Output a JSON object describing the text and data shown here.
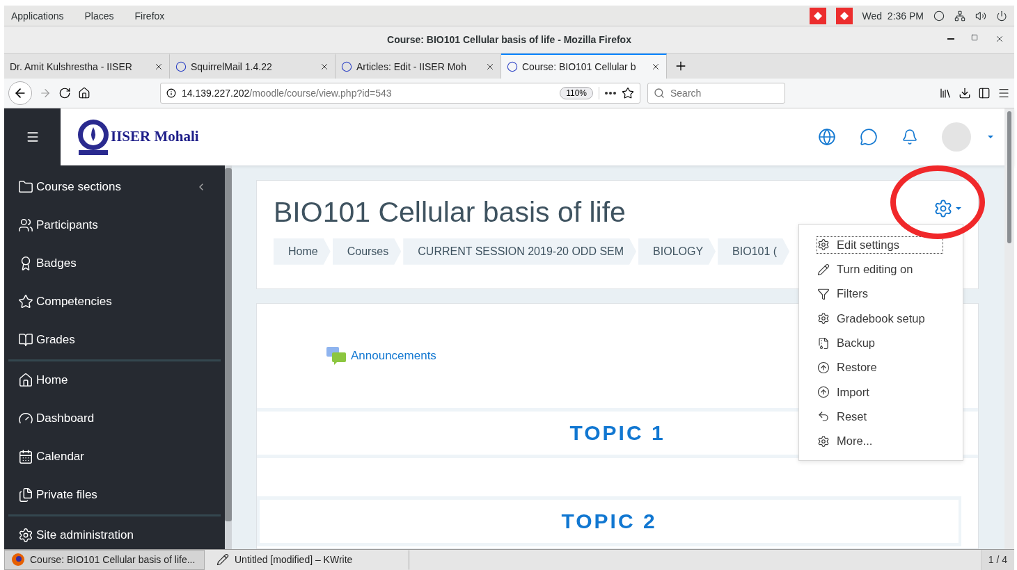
{
  "top_bar": {
    "menus": [
      "Applications",
      "Places",
      "Firefox"
    ],
    "clock": "Wed  2:36 PM"
  },
  "window": {
    "title": "Course: BIO101 Cellular basis of life - Mozilla Firefox"
  },
  "tabs": [
    {
      "label": "Dr. Amit Kulshrestha - IISER",
      "selected": false
    },
    {
      "label": "SquirrelMail 1.4.22",
      "selected": false
    },
    {
      "label": "Articles: Edit - IISER Moh",
      "selected": false
    },
    {
      "label": "Course: BIO101 Cellular b",
      "selected": true
    }
  ],
  "address_bar": {
    "host": "14.139.227.202",
    "path": "/moodle/course/view.php?id=543",
    "zoom": "110%"
  },
  "search": {
    "placeholder": "Search"
  },
  "site": {
    "logo": "IISER Mohali"
  },
  "sidebar": {
    "groups": [
      [
        {
          "label": "Course sections",
          "collapsible": true
        },
        {
          "label": "Participants",
          "collapsible": false
        },
        {
          "label": "Badges",
          "collapsible": false
        },
        {
          "label": "Competencies",
          "collapsible": false
        },
        {
          "label": "Grades",
          "collapsible": false
        }
      ],
      [
        {
          "label": "Home",
          "collapsible": false
        },
        {
          "label": "Dashboard",
          "collapsible": false
        },
        {
          "label": "Calendar",
          "collapsible": false
        },
        {
          "label": "Private files",
          "collapsible": false
        }
      ],
      [
        {
          "label": "Site administration",
          "collapsible": false
        }
      ]
    ]
  },
  "course": {
    "title": "BIO101 Cellular basis of life",
    "breadcrumbs": [
      "Home",
      "Courses",
      "CURRENT SESSION 2019-20 ODD SEM",
      "BIOLOGY",
      "BIO101 ("
    ],
    "activity": "Announcements",
    "topics": [
      "TOPIC 1",
      "TOPIC 2"
    ]
  },
  "settings_menu": {
    "items": [
      {
        "label": "Edit settings",
        "selected": true
      },
      {
        "label": "Turn editing on",
        "selected": false
      },
      {
        "label": "Filters",
        "selected": false
      },
      {
        "label": "Gradebook setup",
        "selected": false
      },
      {
        "label": "Backup",
        "selected": false
      },
      {
        "label": "Restore",
        "selected": false
      },
      {
        "label": "Import",
        "selected": false
      },
      {
        "label": "Reset",
        "selected": false
      },
      {
        "label": "More...",
        "selected": false
      }
    ]
  },
  "taskbar": {
    "items": [
      {
        "label": "Course: BIO101 Cellular basis of life...",
        "selected": true
      },
      {
        "label": "Untitled [modified] – KWrite",
        "selected": false
      }
    ],
    "pager": "1 / 4"
  }
}
